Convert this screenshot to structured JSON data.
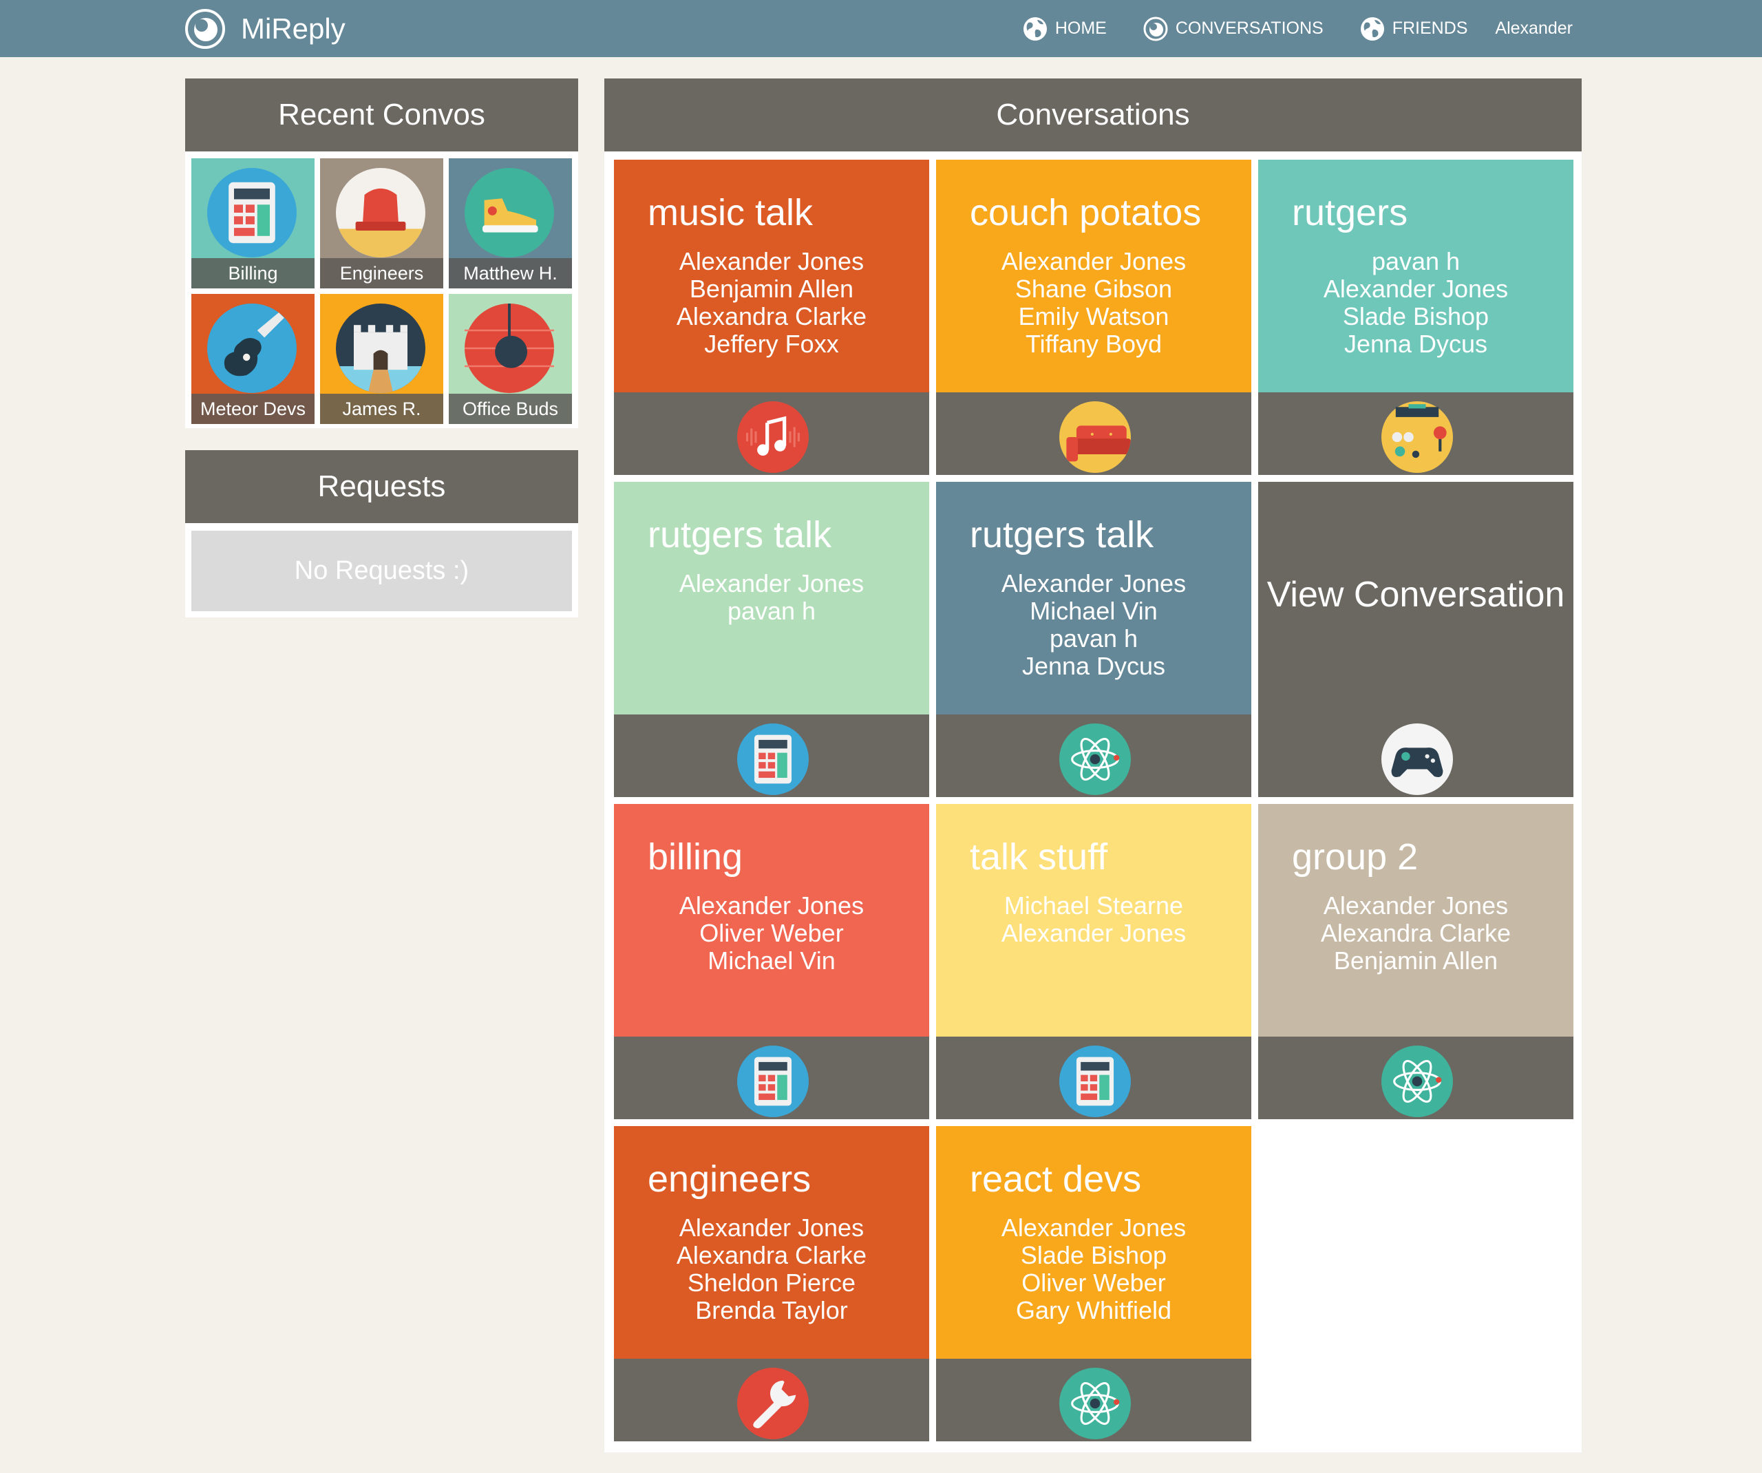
{
  "app": {
    "name": "MiReply"
  },
  "nav": {
    "home": "HOME",
    "conversations": "CONVERSATIONS",
    "friends": "FRIENDS",
    "user": "Alexander"
  },
  "recent": {
    "title": "Recent Convos",
    "items": [
      {
        "label": "Billing",
        "icon": "calculator-icon",
        "bg": "#6ec7b9"
      },
      {
        "label": "Engineers",
        "icon": "siren-icon",
        "bg": "#9e9182"
      },
      {
        "label": "Matthew H.",
        "icon": "sneaker-icon",
        "bg": "#658898"
      },
      {
        "label": "Meteor Devs",
        "icon": "guitar-icon",
        "bg": "#dc5a24"
      },
      {
        "label": "James R.",
        "icon": "castle-icon",
        "bg": "#f9a71b"
      },
      {
        "label": "Office Buds",
        "icon": "wrecking-ball-icon",
        "bg": "#b2dfba"
      }
    ]
  },
  "requests": {
    "title": "Requests",
    "empty": "No Requests :)"
  },
  "conversations": {
    "title": "Conversations",
    "cards": [
      {
        "title": "music talk",
        "members": [
          "Alexander Jones",
          "Benjamin Allen",
          "Alexandra Clarke",
          "Jeffery Foxx"
        ],
        "color": "#dc5a24",
        "icon": "music-icon"
      },
      {
        "title": "couch potatos",
        "members": [
          "Alexander Jones",
          "Shane Gibson",
          "Emily Watson",
          "Tiffany Boyd"
        ],
        "color": "#f9a71b",
        "icon": "couch-icon"
      },
      {
        "title": "rutgers",
        "members": [
          "pavan h",
          "Alexander Jones",
          "Slade Bishop",
          "Jenna Dycus"
        ],
        "color": "#6ec7b9",
        "icon": "arcade-icon"
      },
      {
        "title": "rutgers talk",
        "members": [
          "Alexander Jones",
          "pavan h"
        ],
        "color": "#b2dfba",
        "icon": "calculator-icon"
      },
      {
        "title": "rutgers talk",
        "members": [
          "Alexander Jones",
          "Michael Vin",
          "pavan h",
          "Jenna Dycus"
        ],
        "color": "#658898",
        "icon": "atom-icon"
      },
      {
        "title": "billing",
        "members": [
          "Alexander Jones",
          "Oliver Weber",
          "Michael Vin"
        ],
        "color": "#f16651",
        "icon": "calculator-icon"
      },
      {
        "title": "talk stuff",
        "members": [
          "Michael Stearne",
          "Alexander Jones"
        ],
        "color": "#fee07a",
        "icon": "calculator-icon"
      },
      {
        "title": "group 2",
        "members": [
          "Alexander Jones",
          "Alexandra Clarke",
          "Benjamin Allen"
        ],
        "color": "#c6b9a5",
        "icon": "atom-icon"
      },
      {
        "title": "engineers",
        "members": [
          "Alexander Jones",
          "Alexandra Clarke",
          "Sheldon Pierce",
          "Brenda Taylor"
        ],
        "color": "#dc5a24",
        "icon": "wrench-icon"
      },
      {
        "title": "react devs",
        "members": [
          "Alexander Jones",
          "Slade Bishop",
          "Oliver Weber",
          "Gary Whitfield"
        ],
        "color": "#f9a71b",
        "icon": "atom-icon"
      }
    ],
    "view": {
      "label": "View Conversation",
      "icon": "gamepad-icon"
    }
  }
}
